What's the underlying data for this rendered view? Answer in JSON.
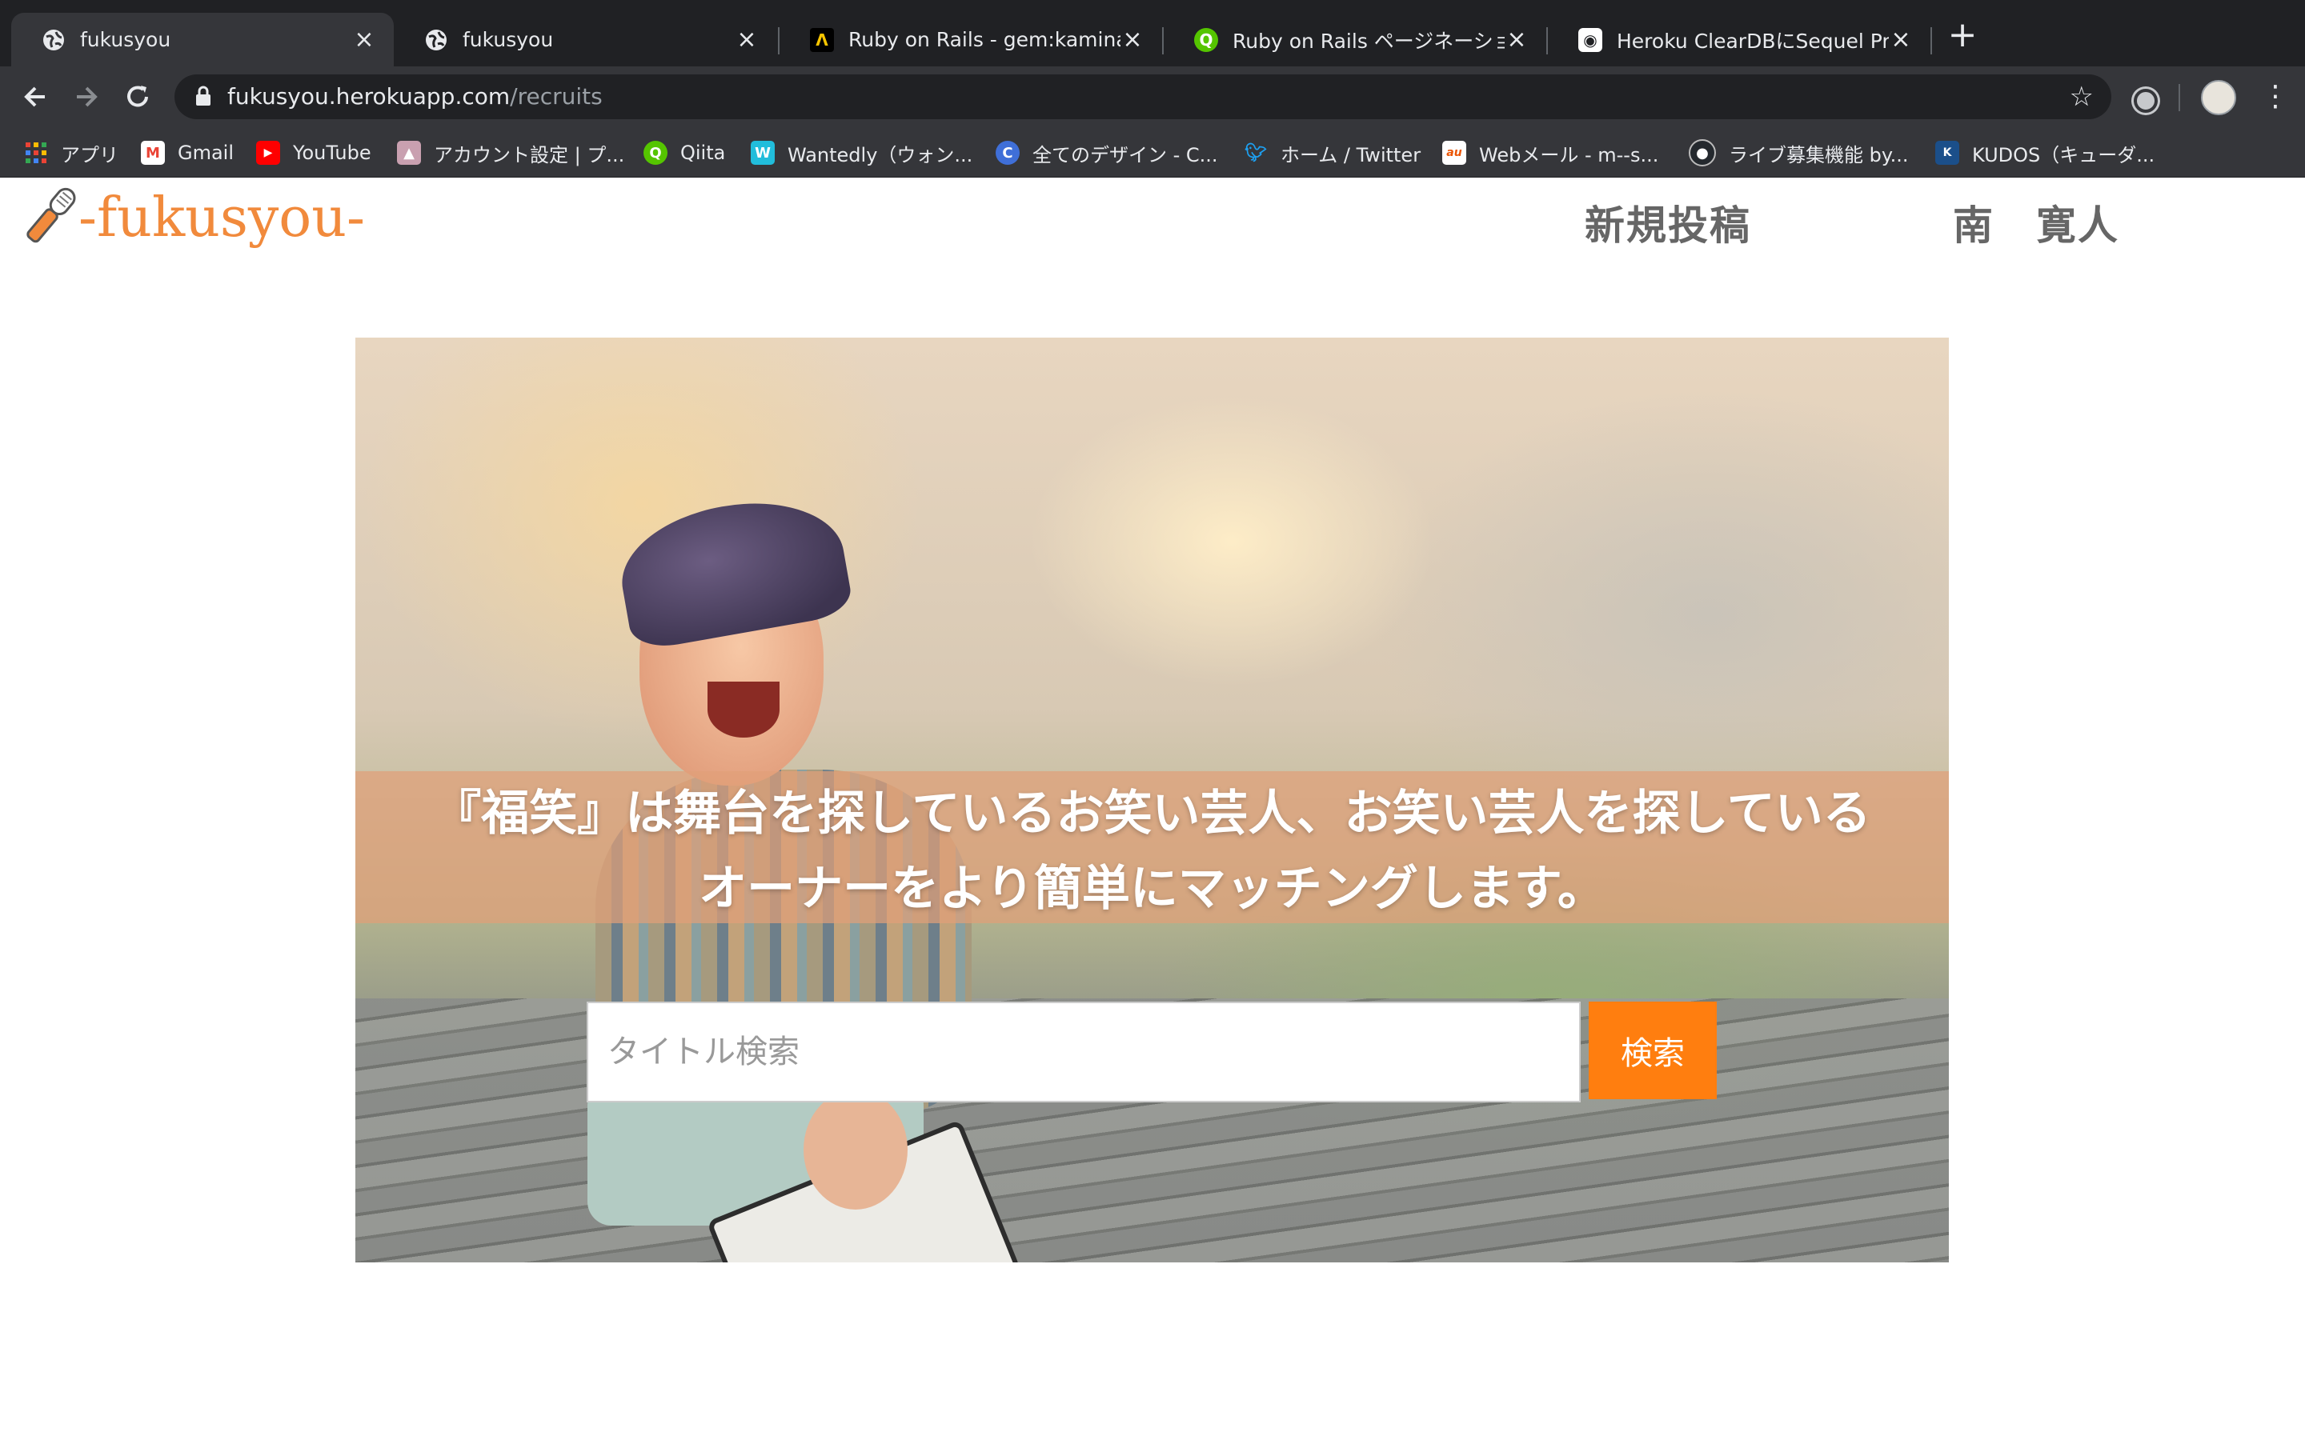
{
  "browser": {
    "tabs": [
      {
        "title": "fukusyou",
        "favicon": "globe-icon",
        "active": true
      },
      {
        "title": "fukusyou",
        "favicon": "globe-icon",
        "active": false
      },
      {
        "title": "Ruby on Rails - gem:kaminari",
        "favicon": "lambda-icon",
        "active": false
      },
      {
        "title": "Ruby on Rails ページネーション",
        "favicon": "qiita-icon",
        "active": false
      },
      {
        "title": "Heroku ClearDBにSequel Pro",
        "favicon": "medium-icon",
        "active": false
      }
    ],
    "url_host": "fukusyou.herokuapp.com",
    "url_path": "/recruits",
    "bookmarks": [
      {
        "label": "アプリ",
        "icon": "apps-grid-icon"
      },
      {
        "label": "Gmail",
        "icon": "gmail-icon"
      },
      {
        "label": "YouTube",
        "icon": "youtube-icon"
      },
      {
        "label": "アカウント設定 | プ...",
        "icon": "account-icon"
      },
      {
        "label": "Qiita",
        "icon": "qiita-icon"
      },
      {
        "label": "Wantedly（ウォン...",
        "icon": "wantedly-icon"
      },
      {
        "label": "全てのデザイン - C...",
        "icon": "canva-icon"
      },
      {
        "label": "ホーム / Twitter",
        "icon": "twitter-icon"
      },
      {
        "label": "Webメール - m--s...",
        "icon": "au-icon"
      },
      {
        "label": "ライブ募集機能 by...",
        "icon": "github-icon"
      },
      {
        "label": "KUDOS（キューダ...",
        "icon": "kudos-icon"
      }
    ]
  },
  "header": {
    "logo_text": "-fukusyou-",
    "logo_icon": "microphone-icon",
    "nav_new_post": "新規投稿",
    "nav_user": "南　寛人"
  },
  "hero": {
    "tagline_line1": "『福笑』は舞台を探しているお笑い芸人、お笑い芸人を探している",
    "tagline_line2": "オーナーをより簡単にマッチングします。",
    "search_placeholder": "タイトル検索",
    "search_button": "検索"
  },
  "colors": {
    "accent": "#ff7e0f",
    "logo": "#f18a3c",
    "nav_text": "#666666"
  }
}
